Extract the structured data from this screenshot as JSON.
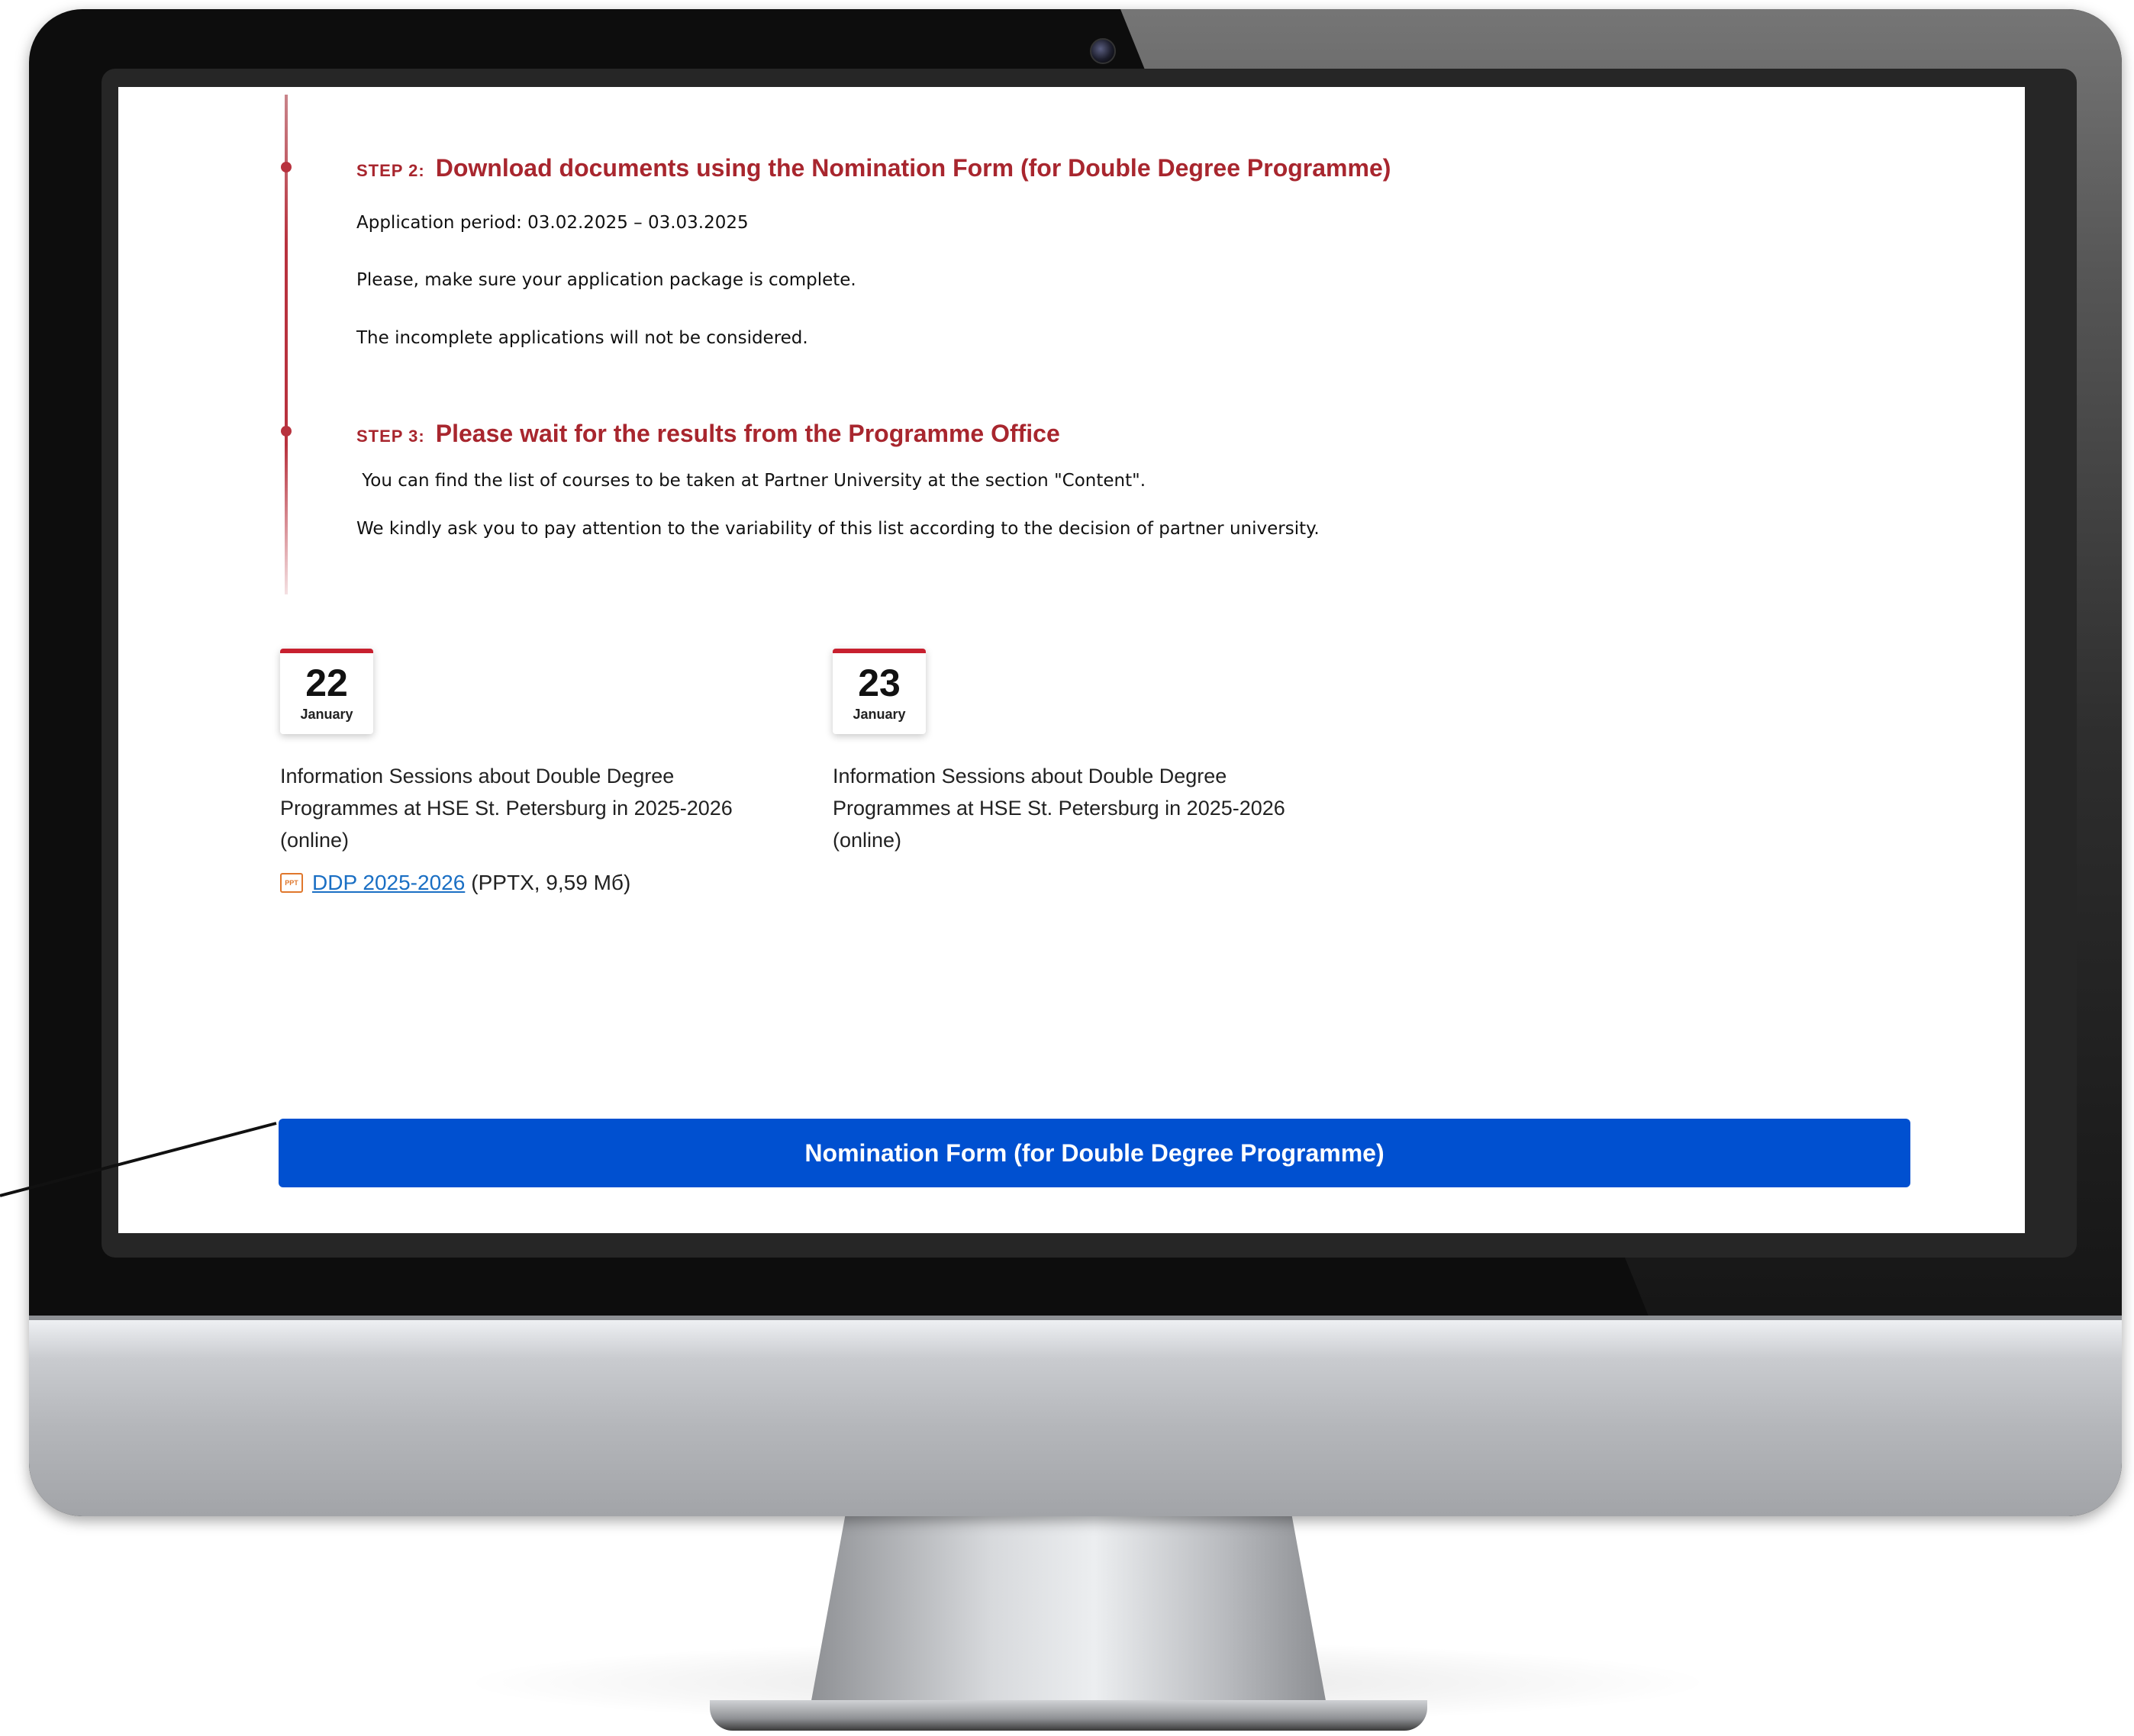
{
  "steps": [
    {
      "label": "STEP 2:",
      "title": "Download documents using the Nomination Form (for Double Degree Programme)",
      "lines": [
        "Application period: 03.02.2025 – 03.03.2025",
        "Please, make sure your application package is complete.",
        "The incomplete applications will not be considered."
      ]
    },
    {
      "label": "STEP 3:",
      "title": "Please wait for the results from the Programme Office",
      "lines": [
        " You can find the list of courses to be taken at Partner University at the section \"Content\".",
        "We kindly ask you to pay attention to the variability of this list according to the decision of partner university."
      ]
    }
  ],
  "events": [
    {
      "day": "22",
      "month": "January",
      "description": "Information Sessions about Double Degree Programmes at HSE St. Petersburg in 2025-2026 (online)",
      "attachment": {
        "icon": "ppt-file-icon",
        "icon_text": "PPT",
        "link_text": "DDP 2025-2026",
        "meta": "(PPTX, 9,59 Мб)"
      }
    },
    {
      "day": "23",
      "month": "January",
      "description": "Information Sessions about Double Degree Programmes at HSE St. Petersburg in 2025-2026 (online)"
    }
  ],
  "nomination_button": "Nomination Form (for Double Degree Programme)",
  "colors": {
    "accent_red": "#a8262e",
    "button_blue": "#0050d0",
    "link_blue": "#1a6fc4"
  }
}
